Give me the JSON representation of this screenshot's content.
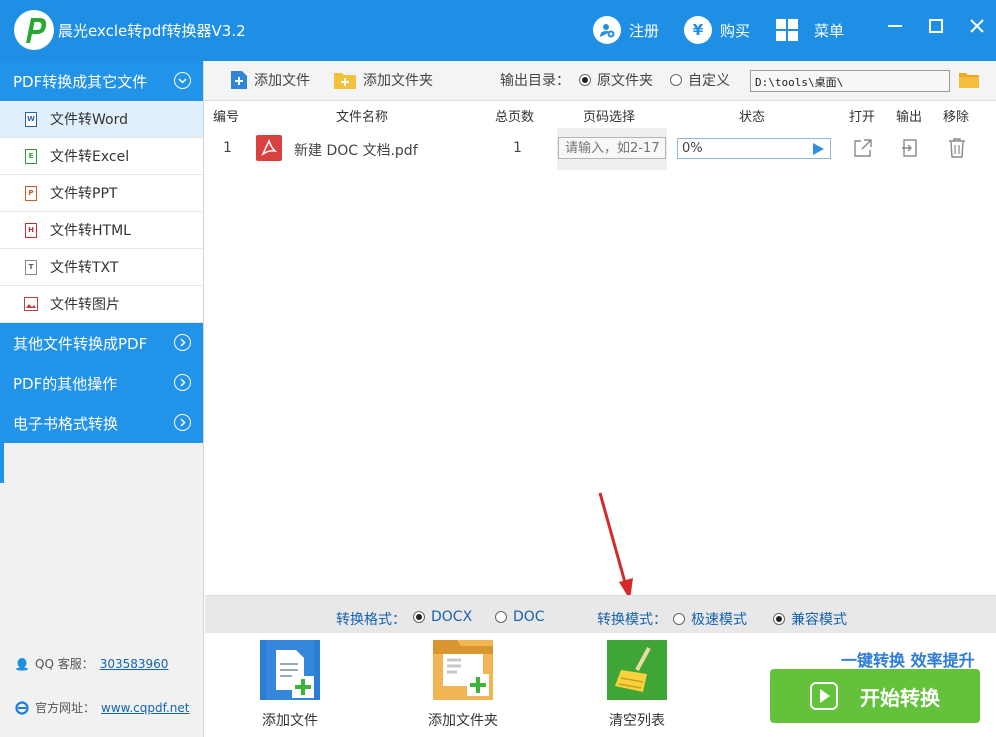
{
  "titlebar": {
    "title": "晨光excle转pdf转换器V3.2",
    "register": "注册",
    "buy": "购买",
    "menu": "菜单",
    "buy_symbol": "¥"
  },
  "sidebar": {
    "categories": [
      {
        "label": "PDF转换成其它文件",
        "expanded": true
      },
      {
        "label": "其他文件转换成PDF",
        "expanded": false
      },
      {
        "label": "PDF的其他操作",
        "expanded": false
      },
      {
        "label": "电子书格式转换",
        "expanded": false
      }
    ],
    "items": [
      {
        "label": "文件转Word",
        "icon": "W",
        "active": true
      },
      {
        "label": "文件转Excel",
        "icon": "E"
      },
      {
        "label": "文件转PPT",
        "icon": "P"
      },
      {
        "label": "文件转HTML",
        "icon": "H"
      },
      {
        "label": "文件转TXT",
        "icon": "T"
      },
      {
        "label": "文件转图片",
        "icon": "img"
      }
    ],
    "qq_label": "QQ 客服：",
    "qq_value": "303583960",
    "site_label": "官方网址：",
    "site_value": "www.cqpdf.net"
  },
  "toolbar": {
    "add_file": "添加文件",
    "add_folder": "添加文件夹",
    "output_label": "输出目录：",
    "opt_source": "原文件夹",
    "opt_custom": "自定义",
    "path": "D:\\tools\\桌面\\"
  },
  "table": {
    "headers": [
      "编号",
      "文件名称",
      "总页数",
      "页码选择",
      "状态",
      "打开",
      "输出",
      "移除"
    ],
    "rows": [
      {
        "index": "1",
        "name": "新建 DOC 文档.pdf",
        "pages": "1",
        "page_placeholder": "请输入，如2-17",
        "progress": "0%"
      }
    ]
  },
  "options": {
    "format_label": "转换格式：",
    "format_docx": "DOCX",
    "format_doc": "DOC",
    "mode_label": "转换模式：",
    "mode_fast": "极速模式",
    "mode_compat": "兼容模式"
  },
  "bottom": {
    "add_file": "添加文件",
    "add_folder": "添加文件夹",
    "clear_list": "清空列表",
    "slogan": "一键转换  效率提升",
    "start": "开始转换"
  },
  "colors": {
    "titlebar": "#1f8fe6",
    "accent": "#2193e8",
    "start": "#63c13b",
    "link": "#1662b0"
  }
}
